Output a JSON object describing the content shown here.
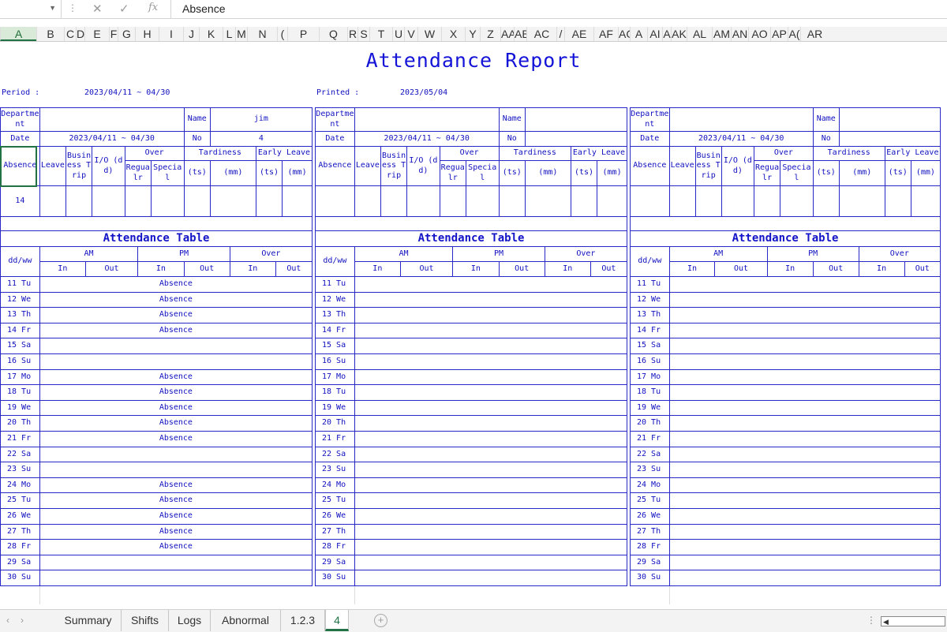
{
  "formula_bar": {
    "name_box": "",
    "formula": "Absence"
  },
  "columns": [
    "A",
    "B",
    "C",
    "D",
    "E",
    "F",
    "G",
    "H",
    "I",
    "J",
    "K",
    "L",
    "M",
    "N",
    "O",
    "P",
    "Q",
    "R",
    "S",
    "T",
    "U",
    "V",
    "W",
    "X",
    "Y",
    "Z",
    "AA",
    "AB",
    "AC",
    "AD",
    "AE",
    "AF",
    "AG",
    "AH",
    "AI",
    "AJ",
    "AK",
    "AL",
    "AM",
    "AN",
    "AO",
    "AP",
    "AQ",
    "AR"
  ],
  "column_labels": [
    "A",
    "B",
    "C",
    "D",
    "E",
    "F",
    "G",
    "H",
    "I",
    "J",
    "K",
    "L",
    "M",
    "N",
    "(",
    "P",
    "Q",
    "R",
    "S",
    "T",
    "U",
    "V",
    "W",
    "X",
    "Y",
    "Z",
    "AA",
    "AB",
    "AC",
    "/",
    "AE",
    "AF",
    "AG",
    "A",
    "AI",
    "A",
    "AK",
    "AL",
    "AM",
    "AN",
    "AO",
    "AP",
    "A(",
    "AR"
  ],
  "report": {
    "title": "Attendance Report",
    "period_label": "Period :",
    "period_value": "2023/04/11 ~ 04/30",
    "printed_label": "Printed :",
    "printed_value": "2023/05/04"
  },
  "labels": {
    "department": "Department",
    "name": "Name",
    "date": "Date",
    "no": "No",
    "absence": "Absence",
    "leave": "Leave",
    "business_trip": "Business Trip",
    "io": "I/O (dd)",
    "over": "Over",
    "regular": "Regualr",
    "special": "Special",
    "tardiness": "Tardiness",
    "early_leave": "Early Leave",
    "ts": "(ts)",
    "mm": "(mm)",
    "attendance_table": "Attendance Table",
    "ddww": "dd/ww",
    "am": "AM",
    "pm": "PM",
    "in": "In",
    "out": "Out"
  },
  "blocks": [
    {
      "department": "",
      "name": "jim",
      "date": "2023/04/11 ~ 04/30",
      "no": "4",
      "absence": "14",
      "leave": "",
      "business_trip": "",
      "io": "",
      "over_regular": "",
      "over_special": "",
      "tardiness_ts": "",
      "tardiness_mm": "",
      "early_ts": "",
      "early_mm": ""
    },
    {
      "department": "",
      "name": "",
      "date": "2023/04/11 ~ 04/30",
      "no": "",
      "absence": "",
      "leave": "",
      "business_trip": "",
      "io": "",
      "over_regular": "",
      "over_special": "",
      "tardiness_ts": "",
      "tardiness_mm": "",
      "early_ts": "",
      "early_mm": ""
    },
    {
      "department": "",
      "name": "",
      "date": "2023/04/11 ~ 04/30",
      "no": "",
      "absence": "",
      "leave": "",
      "business_trip": "",
      "io": "",
      "over_regular": "",
      "over_special": "",
      "tardiness_ts": "",
      "tardiness_mm": "",
      "early_ts": "",
      "early_mm": ""
    }
  ],
  "days": [
    "11 Tu",
    "12 We",
    "13 Th",
    "14 Fr",
    "15 Sa",
    "16 Su",
    "17 Mo",
    "18 Tu",
    "19 We",
    "20 Th",
    "21 Fr",
    "22 Sa",
    "23 Su",
    "24 Mo",
    "25 Tu",
    "26 We",
    "27 Th",
    "28 Fr",
    "29 Sa",
    "30 Su"
  ],
  "block_status": [
    [
      "Absence",
      "Absence",
      "Absence",
      "Absence",
      "",
      "",
      "Absence",
      "Absence",
      "Absence",
      "Absence",
      "Absence",
      "",
      "",
      "Absence",
      "Absence",
      "Absence",
      "Absence",
      "Absence",
      "",
      ""
    ],
    [
      "",
      "",
      "",
      "",
      "",
      "",
      "",
      "",
      "",
      "",
      "",
      "",
      "",
      "",
      "",
      "",
      "",
      "",
      "",
      ""
    ],
    [
      "",
      "",
      "",
      "",
      "",
      "",
      "",
      "",
      "",
      "",
      "",
      "",
      "",
      "",
      "",
      "",
      "",
      "",
      "",
      ""
    ]
  ],
  "sheet_tabs": [
    "Summary",
    "Shifts",
    "Logs",
    "Abnormal",
    "1.2.3",
    "4"
  ],
  "active_tab": "4",
  "colors": {
    "report_blue": "#1414d8",
    "grid_blue": "#2828c8",
    "excel_green": "#217346"
  }
}
